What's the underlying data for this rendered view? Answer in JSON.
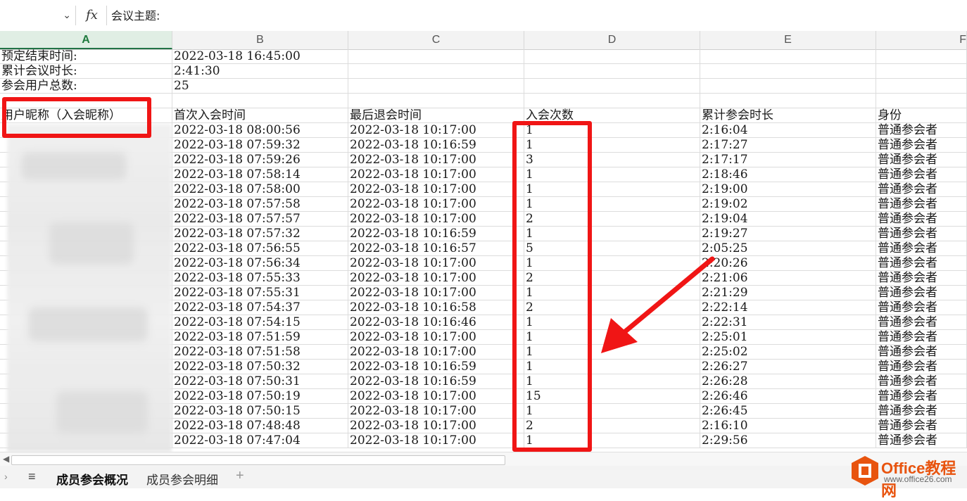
{
  "formula_bar": {
    "name_box_value": "",
    "fx_label": "fx",
    "formula": "会议主题:",
    "chevron": "⌄"
  },
  "columns": [
    "A",
    "B",
    "C",
    "D",
    "E",
    "F"
  ],
  "active_column": "A",
  "info_rows": [
    {
      "label": "预定结束时间:",
      "value": "2022-03-18 16:45:00"
    },
    {
      "label": "累计会议时长:",
      "value": "2:41:30"
    },
    {
      "label": "参会用户总数:",
      "value": "25"
    }
  ],
  "table_headers": [
    "用户昵称（入会昵称）",
    "首次入会时间",
    "最后退会时间",
    "入会次数",
    "累计参会时长",
    "身份"
  ],
  "rows": [
    {
      "first_join": "2022-03-18 08:00:56",
      "last_leave": "2022-03-18 10:17:00",
      "count": "1",
      "duration": "2:16:04",
      "role": "普通参会者"
    },
    {
      "first_join": "2022-03-18 07:59:32",
      "last_leave": "2022-03-18 10:16:59",
      "count": "1",
      "duration": "2:17:27",
      "role": "普通参会者"
    },
    {
      "first_join": "2022-03-18 07:59:26",
      "last_leave": "2022-03-18 10:17:00",
      "count": "3",
      "duration": "2:17:17",
      "role": "普通参会者"
    },
    {
      "first_join": "2022-03-18 07:58:14",
      "last_leave": "2022-03-18 10:17:00",
      "count": "1",
      "duration": "2:18:46",
      "role": "普通参会者"
    },
    {
      "first_join": "2022-03-18 07:58:00",
      "last_leave": "2022-03-18 10:17:00",
      "count": "1",
      "duration": "2:19:00",
      "role": "普通参会者"
    },
    {
      "first_join": "2022-03-18 07:57:58",
      "last_leave": "2022-03-18 10:17:00",
      "count": "1",
      "duration": "2:19:02",
      "role": "普通参会者"
    },
    {
      "first_join": "2022-03-18 07:57:57",
      "last_leave": "2022-03-18 10:17:00",
      "count": "2",
      "duration": "2:19:04",
      "role": "普通参会者"
    },
    {
      "first_join": "2022-03-18 07:57:32",
      "last_leave": "2022-03-18 10:16:59",
      "count": "1",
      "duration": "2:19:27",
      "role": "普通参会者"
    },
    {
      "first_join": "2022-03-18 07:56:55",
      "last_leave": "2022-03-18 10:16:57",
      "count": "5",
      "duration": "2:05:25",
      "role": "普通参会者"
    },
    {
      "first_join": "2022-03-18 07:56:34",
      "last_leave": "2022-03-18 10:17:00",
      "count": "1",
      "duration": "2:20:26",
      "role": "普通参会者"
    },
    {
      "first_join": "2022-03-18 07:55:33",
      "last_leave": "2022-03-18 10:17:00",
      "count": "2",
      "duration": "2:21:06",
      "role": "普通参会者"
    },
    {
      "first_join": "2022-03-18 07:55:31",
      "last_leave": "2022-03-18 10:17:00",
      "count": "1",
      "duration": "2:21:29",
      "role": "普通参会者"
    },
    {
      "first_join": "2022-03-18 07:54:37",
      "last_leave": "2022-03-18 10:16:58",
      "count": "2",
      "duration": "2:22:14",
      "role": "普通参会者"
    },
    {
      "first_join": "2022-03-18 07:54:15",
      "last_leave": "2022-03-18 10:16:46",
      "count": "1",
      "duration": "2:22:31",
      "role": "普通参会者"
    },
    {
      "first_join": "2022-03-18 07:51:59",
      "last_leave": "2022-03-18 10:17:00",
      "count": "1",
      "duration": "2:25:01",
      "role": "普通参会者"
    },
    {
      "first_join": "2022-03-18 07:51:58",
      "last_leave": "2022-03-18 10:17:00",
      "count": "1",
      "duration": "2:25:02",
      "role": "普通参会者"
    },
    {
      "first_join": "2022-03-18 07:50:32",
      "last_leave": "2022-03-18 10:16:59",
      "count": "1",
      "duration": "2:26:27",
      "role": "普通参会者"
    },
    {
      "first_join": "2022-03-18 07:50:31",
      "last_leave": "2022-03-18 10:16:59",
      "count": "1",
      "duration": "2:26:28",
      "role": "普通参会者"
    },
    {
      "first_join": "2022-03-18 07:50:19",
      "last_leave": "2022-03-18 10:17:00",
      "count": "15",
      "duration": "2:26:46",
      "role": "普通参会者"
    },
    {
      "first_join": "2022-03-18 07:50:15",
      "last_leave": "2022-03-18 10:17:00",
      "count": "1",
      "duration": "2:26:45",
      "role": "普通参会者"
    },
    {
      "first_join": "2022-03-18 07:48:48",
      "last_leave": "2022-03-18 10:17:00",
      "count": "2",
      "duration": "2:16:10",
      "role": "普通参会者"
    },
    {
      "first_join": "2022-03-18 07:47:04",
      "last_leave": "2022-03-18 10:17:00",
      "count": "1",
      "duration": "2:29:56",
      "role": "普通参会者"
    }
  ],
  "sheet_tabs": {
    "active": "成员参会概况",
    "other": "成员参会明细",
    "add": "+",
    "menu_icon": "≡",
    "nav_icon": "›"
  },
  "watermark": {
    "title": "Office教程网",
    "url": "www.office26.com"
  },
  "colors": {
    "annotation_red": "#f01515",
    "active_column_green": "#217346",
    "logo_orange": "#e8540f"
  }
}
